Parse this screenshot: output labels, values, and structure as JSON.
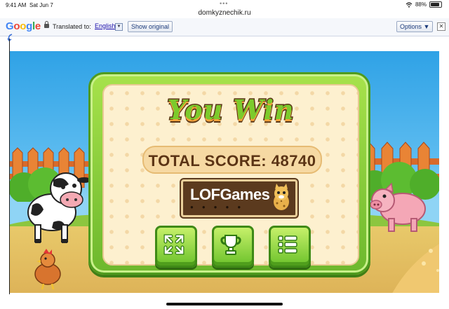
{
  "status_bar": {
    "time": "9:41 AM",
    "date": "Sat Jun 7",
    "battery": "88%"
  },
  "browser": {
    "url": "domkyznechik.ru"
  },
  "translate_bar": {
    "logo": "Google",
    "label": "Translated to:",
    "language": "English",
    "show_original": "Show original",
    "options": "Options ▼",
    "close": "✕"
  },
  "game": {
    "title": "You Win",
    "score_label": "TOTAL SCORE:",
    "score_value": "48740",
    "sponsor_logo": "LOFGames",
    "buttons": [
      {
        "icon": "fullscreen-icon"
      },
      {
        "icon": "trophy-icon"
      },
      {
        "icon": "menu-list-icon"
      }
    ],
    "colors": {
      "panel_green": "#8cd33a",
      "panel_cream": "#fdf0cf",
      "score_text": "#5b3415",
      "sky": "#2fa2e6"
    }
  }
}
